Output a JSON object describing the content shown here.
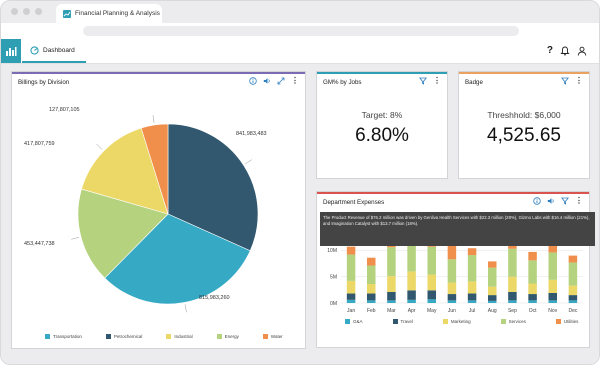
{
  "browser": {
    "tab_title": "Financial Planning & Analysis"
  },
  "app": {
    "tab_label": "Dashboard",
    "help_label": "?"
  },
  "colors": {
    "transportation": "#36a9c5",
    "petrochemical": "#31586f",
    "industrial": "#ecd867",
    "energy": "#b5d27f",
    "water": "#f08f4b",
    "accent": "#2e9fb3"
  },
  "billings": {
    "title": "Billings by Division",
    "labels": [
      "127,807,105",
      "417,807,759",
      "453,447,738",
      "815,983,260",
      "841,983,483"
    ],
    "legend": [
      "Transportation",
      "Petrochemical",
      "Industrial",
      "Energy",
      "Water"
    ]
  },
  "gm": {
    "title": "GM% by Jobs",
    "target": "Target: 8%",
    "value": "6.80%"
  },
  "badge": {
    "title": "Badge",
    "threshold": "Threshhold: $6,000",
    "value": "4,525.65"
  },
  "expenses": {
    "title": "Department Expenses",
    "tooltip": "The Product Revenue of $76.2 million was driven by Genliva Health Services with $22.3 million (28%), Gizmo Labs with $16.4 million (21%), and Imagination Catalyst with $13.7 million (18%).",
    "legend": [
      "G&A",
      "Travel",
      "Marketing",
      "Services",
      "Utilities"
    ]
  },
  "chart_data": [
    {
      "type": "pie",
      "title": "Billings by Division",
      "categories": [
        "Transportation",
        "Petrochemical",
        "Industrial",
        "Energy",
        "Water"
      ],
      "values": [
        815983260,
        841983483,
        417807759,
        453447738,
        127807105
      ],
      "legend": "bottom"
    },
    {
      "type": "bar",
      "stacked": true,
      "title": "Department Expenses",
      "categories": [
        "Jan",
        "Feb",
        "Mar",
        "Apr",
        "May",
        "Jun",
        "Jul",
        "Aug",
        "Sep",
        "Oct",
        "Nov",
        "Dec"
      ],
      "y_ticks": [
        "0M",
        "5M",
        "10M"
      ],
      "ylim": [
        0,
        15
      ],
      "series": [
        {
          "name": "G&A",
          "values": [
            0.6,
            0.5,
            0.5,
            0.6,
            0.7,
            0.5,
            0.5,
            0.4,
            0.5,
            0.5,
            0.5,
            0.5
          ]
        },
        {
          "name": "Travel",
          "values": [
            1.2,
            1.3,
            1.6,
            1.8,
            1.7,
            1.2,
            1.3,
            1.1,
            1.6,
            1.2,
            1.4,
            1.0
          ]
        },
        {
          "name": "Marketing",
          "values": [
            2.4,
            1.8,
            3.0,
            3.6,
            3.0,
            2.2,
            2.3,
            1.6,
            2.9,
            2.0,
            2.5,
            1.8
          ]
        },
        {
          "name": "Services",
          "values": [
            5.0,
            3.5,
            5.5,
            6.6,
            5.3,
            4.4,
            5.0,
            3.6,
            5.3,
            4.4,
            5.2,
            4.4
          ]
        },
        {
          "name": "Utilities",
          "values": [
            1.5,
            1.5,
            1.9,
            2.3,
            1.5,
            2.6,
            1.3,
            1.2,
            1.4,
            1.6,
            1.5,
            1.3
          ]
        }
      ],
      "legend": "bottom"
    }
  ]
}
